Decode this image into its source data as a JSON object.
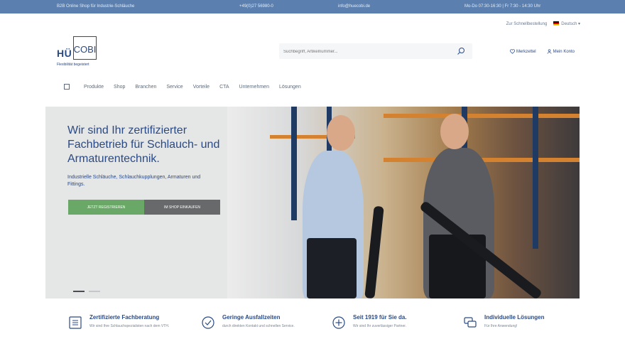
{
  "topbar": {
    "item1": "B2B Online Shop für Industrie-Schläuche",
    "item2": "+49(0)27 56980-0",
    "item3": "info@huecobi.de",
    "item4": "Mo-Do 07:30-16:30 | Fr 7:30 - 14:30 Uhr"
  },
  "utility": {
    "wishlist": "Zur Schnellbestellung",
    "language": "Deutsch"
  },
  "logo": {
    "hu": "HÜ",
    "cobi": "COBI",
    "tagline": "Flexibilität begeistert"
  },
  "search": {
    "placeholder": "Suchbegriff, Artikelnummer..."
  },
  "header_links": {
    "wishlist": "Merkzettel",
    "account": "Mein Konto"
  },
  "nav": {
    "items": [
      "Produkte",
      "Shop",
      "Branchen",
      "Service",
      "Vorteile",
      "CTA",
      "Unternehmen",
      "Lösungen"
    ]
  },
  "hero": {
    "title": "Wir sind Ihr zertifizierter Fachbetrieb für Schlauch- und Armaturentechnik.",
    "subtitle": "Industrielle Schläuche, Schlauchkupplungen, Armaturen und Fittings.",
    "btn_register": "Jetzt registrieren",
    "btn_shop": "Im Shop einkaufen"
  },
  "features": [
    {
      "title": "Zertifizierte Fachberatung",
      "desc": "Wir sind Ihre Schlauchspezialisten nach dem VTH."
    },
    {
      "title": "Geringe Ausfallzeiten",
      "desc": "durch direkten Kontakt und schnellen Service."
    },
    {
      "title": "Seit 1919 für Sie da.",
      "desc": "Wir sind Ihr zuverlässiger Partner."
    },
    {
      "title": "Individuelle Lösungen",
      "desc": "Für Ihre Anwendung!"
    }
  ],
  "colors": {
    "primary": "#2a4a86",
    "topbar": "#5b7fae",
    "green": "#6aa867",
    "grey": "#68696b"
  }
}
